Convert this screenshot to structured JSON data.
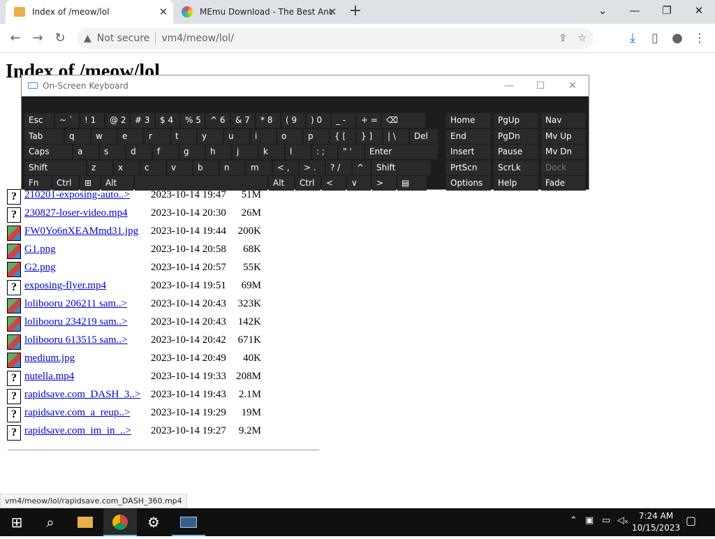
{
  "browser": {
    "tabs": [
      {
        "title": "Index of /meow/lol",
        "icon": "folder-icon"
      },
      {
        "title": "MEmu Download - The Best And",
        "icon": "memu-logo-icon"
      }
    ],
    "address": {
      "security": "Not secure",
      "url": "vm4/meow/lol/"
    },
    "status_url": "vm4/meow/lol/rapidsave.com_DASH_360.mp4"
  },
  "page": {
    "title": "Index of /meow/lol",
    "files": [
      {
        "name": "210201-exposing-auto..>",
        "date": "2023-10-14 19:47",
        "size": "51M",
        "icon": "unknown"
      },
      {
        "name": "230827-loser-video.mp4",
        "date": "2023-10-14 20:30",
        "size": "26M",
        "icon": "unknown"
      },
      {
        "name": "FW0Yo6nXEAMmd31.jpg",
        "date": "2023-10-14 19:44",
        "size": "200K",
        "icon": "image"
      },
      {
        "name": "G1.png",
        "date": "2023-10-14 20:58",
        "size": "68K",
        "icon": "image"
      },
      {
        "name": "G2.png",
        "date": "2023-10-14 20:57",
        "size": "55K",
        "icon": "image"
      },
      {
        "name": "exposing-flyer.mp4",
        "date": "2023-10-14 19:51",
        "size": "69M",
        "icon": "unknown"
      },
      {
        "name": "lolibooru 206211 sam..>",
        "date": "2023-10-14 20:43",
        "size": "323K",
        "icon": "image"
      },
      {
        "name": "lolibooru 234219 sam..>",
        "date": "2023-10-14 20:43",
        "size": "142K",
        "icon": "image"
      },
      {
        "name": "lolibooru 613515 sam..>",
        "date": "2023-10-14 20:42",
        "size": "671K",
        "icon": "image"
      },
      {
        "name": "medium.jpg",
        "date": "2023-10-14 20:49",
        "size": "40K",
        "icon": "image"
      },
      {
        "name": "nutella.mp4",
        "date": "2023-10-14 19:33",
        "size": "208M",
        "icon": "unknown"
      },
      {
        "name": "rapidsave.com_DASH_3..>",
        "date": "2023-10-14 19:43",
        "size": "2.1M",
        "icon": "unknown"
      },
      {
        "name": "rapidsave.com_a_reup..>",
        "date": "2023-10-14 19:29",
        "size": "19M",
        "icon": "unknown"
      },
      {
        "name": "rapidsave.com_im_in_..>",
        "date": "2023-10-14 19:27",
        "size": "9.2M",
        "icon": "unknown"
      }
    ]
  },
  "osk": {
    "title": "On-Screen Keyboard",
    "rows": [
      [
        "Esc",
        "~ `",
        "! 1",
        "@ 2",
        "# 3",
        "$ 4",
        "% 5",
        "^ 6",
        "& 7",
        "* 8",
        "( 9",
        ") 0",
        "_ -",
        "+ =",
        "⌫"
      ],
      [
        "Tab",
        "q",
        "w",
        "e",
        "r",
        "t",
        "y",
        "u",
        "i",
        "o",
        "p",
        "{ [",
        "} ]",
        "| \\",
        "Del"
      ],
      [
        "Caps",
        "a",
        "s",
        "d",
        "f",
        "g",
        "h",
        "j",
        "k",
        "l",
        ": ;",
        "\" '",
        "Enter"
      ],
      [
        "Shift",
        "z",
        "x",
        "c",
        "v",
        "b",
        "n",
        "m",
        "< ,",
        "> .",
        "? /",
        "^",
        "Shift"
      ],
      [
        "Fn",
        "Ctrl",
        "⊞",
        "Alt",
        "",
        "Alt",
        "Ctrl",
        "<",
        "∨",
        ">",
        "▤"
      ]
    ],
    "side": [
      [
        "Home",
        "PgUp",
        "Nav"
      ],
      [
        "End",
        "PgDn",
        "Mv Up"
      ],
      [
        "Insert",
        "Pause",
        "Mv Dn"
      ],
      [
        "PrtScn",
        "ScrLk",
        "Dock"
      ],
      [
        "Options",
        "Help",
        "Fade"
      ]
    ]
  },
  "taskbar": {
    "time": "7:24 AM",
    "date": "10/15/2023"
  }
}
